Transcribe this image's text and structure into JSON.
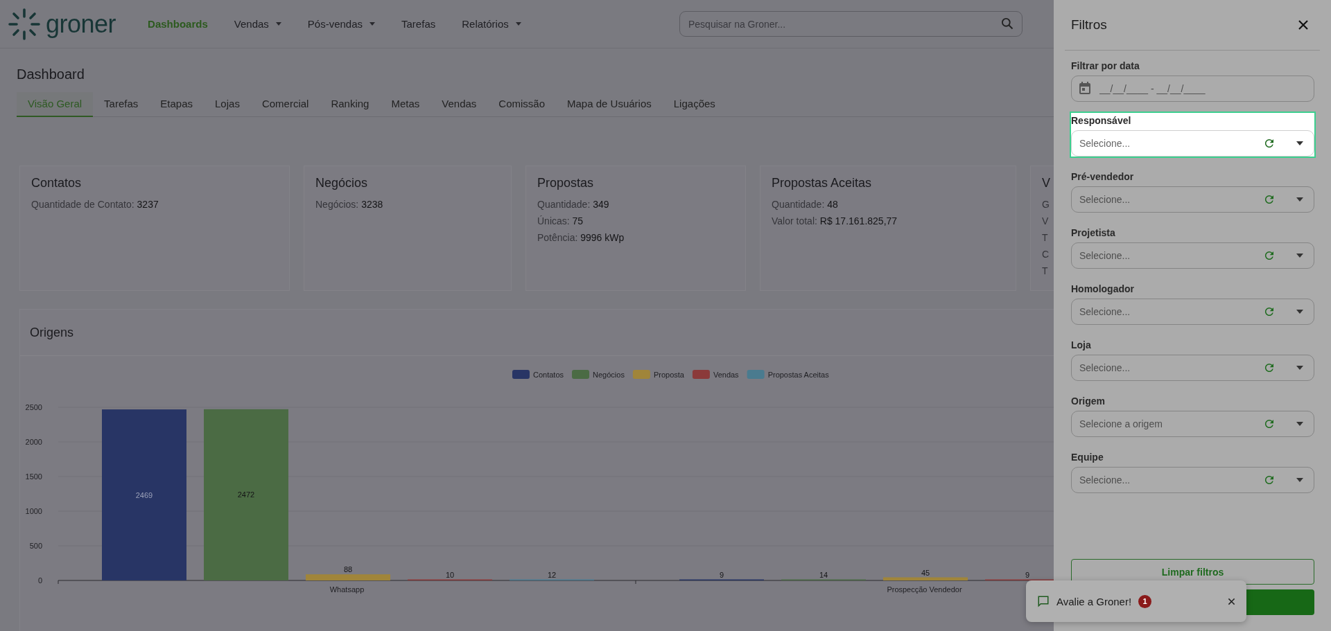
{
  "header": {
    "logo": "groner",
    "nav": [
      {
        "label": "Dashboards",
        "selected": true,
        "dropdown": false
      },
      {
        "label": "Vendas",
        "selected": false,
        "dropdown": true
      },
      {
        "label": "Pós-vendas",
        "selected": false,
        "dropdown": true
      },
      {
        "label": "Tarefas",
        "selected": false,
        "dropdown": false
      },
      {
        "label": "Relatórios",
        "selected": false,
        "dropdown": true
      }
    ],
    "search": {
      "placeholder": "Pesquisar na Groner..."
    }
  },
  "page_title": "Dashboard",
  "tabs": [
    {
      "label": "Visão Geral",
      "selected": true
    },
    {
      "label": "Tarefas",
      "selected": false
    },
    {
      "label": "Etapas",
      "selected": false
    },
    {
      "label": "Lojas",
      "selected": false
    },
    {
      "label": "Comercial",
      "selected": false
    },
    {
      "label": "Ranking",
      "selected": false
    },
    {
      "label": "Metas",
      "selected": false
    },
    {
      "label": "Vendas",
      "selected": false
    },
    {
      "label": "Comissão",
      "selected": false
    },
    {
      "label": "Mapa de Usuários",
      "selected": false
    },
    {
      "label": "Ligações",
      "selected": false
    }
  ],
  "cards": [
    {
      "title": "Contatos",
      "lines": [
        {
          "label": "Quantidade de Contato:",
          "value": "3237"
        }
      ]
    },
    {
      "title": "Negócios",
      "lines": [
        {
          "label": "Negócios:",
          "value": "3238"
        }
      ]
    },
    {
      "title": "Propostas",
      "lines": [
        {
          "label": "Quantidade:",
          "value": "349"
        },
        {
          "label": "Únicas:",
          "value": "75"
        },
        {
          "label": "Potência:",
          "value": "9996 kWp"
        }
      ]
    },
    {
      "title": "Propostas Aceitas",
      "lines": [
        {
          "label": "Quantidade:",
          "value": "48"
        },
        {
          "label": "Valor total:",
          "value": "R$ 17.161.825,77"
        }
      ]
    },
    {
      "title": "V",
      "lines": [
        {
          "label": "G"
        },
        {
          "label": "V"
        },
        {
          "label": "T"
        },
        {
          "label": "C"
        },
        {
          "label": "T"
        }
      ]
    }
  ],
  "origins": {
    "title": "Origens",
    "chart_data": {
      "type": "bar",
      "categories": [
        "Whatsapp",
        "Prospecção Vendedor"
      ],
      "series": [
        {
          "name": "Contatos",
          "color": "#283565",
          "values": [
            2469,
            9
          ]
        },
        {
          "name": "Negócios",
          "color": "#4b6b44",
          "values": [
            2472,
            14
          ]
        },
        {
          "name": "Proposta",
          "color": "#a0853a",
          "values": [
            88,
            45
          ]
        },
        {
          "name": "Vendas",
          "color": "#8b3a3a",
          "values": [
            10,
            9
          ]
        },
        {
          "name": "Propostas Aceitas",
          "color": "#4a7b8f",
          "values": [
            12,
            null
          ]
        }
      ],
      "legend": "top",
      "ylim": [
        0,
        2500
      ],
      "yticks": [
        0,
        500,
        1000,
        1500,
        2000,
        2500
      ],
      "data_labels": true
    }
  },
  "filters": {
    "title": "Filtros",
    "date": {
      "label": "Filtrar por data",
      "placeholder": "__/__/____ - __/__/____"
    },
    "selects": [
      {
        "label": "Responsável",
        "placeholder": "Selecione...",
        "highlighted": true
      },
      {
        "label": "Pré-vendedor",
        "placeholder": "Selecione...",
        "highlighted": false
      },
      {
        "label": "Projetista",
        "placeholder": "Selecione...",
        "highlighted": false
      },
      {
        "label": "Homologador",
        "placeholder": "Selecione...",
        "highlighted": false
      },
      {
        "label": "Loja",
        "placeholder": "Selecione...",
        "highlighted": false
      },
      {
        "label": "Origem",
        "placeholder": "Selecione a origem",
        "highlighted": false
      },
      {
        "label": "Equipe",
        "placeholder": "Selecione...",
        "highlighted": false
      }
    ],
    "clear_button": "Limpar filtros"
  },
  "toast": {
    "text": "Avalie a Groner!",
    "badge": "1"
  }
}
